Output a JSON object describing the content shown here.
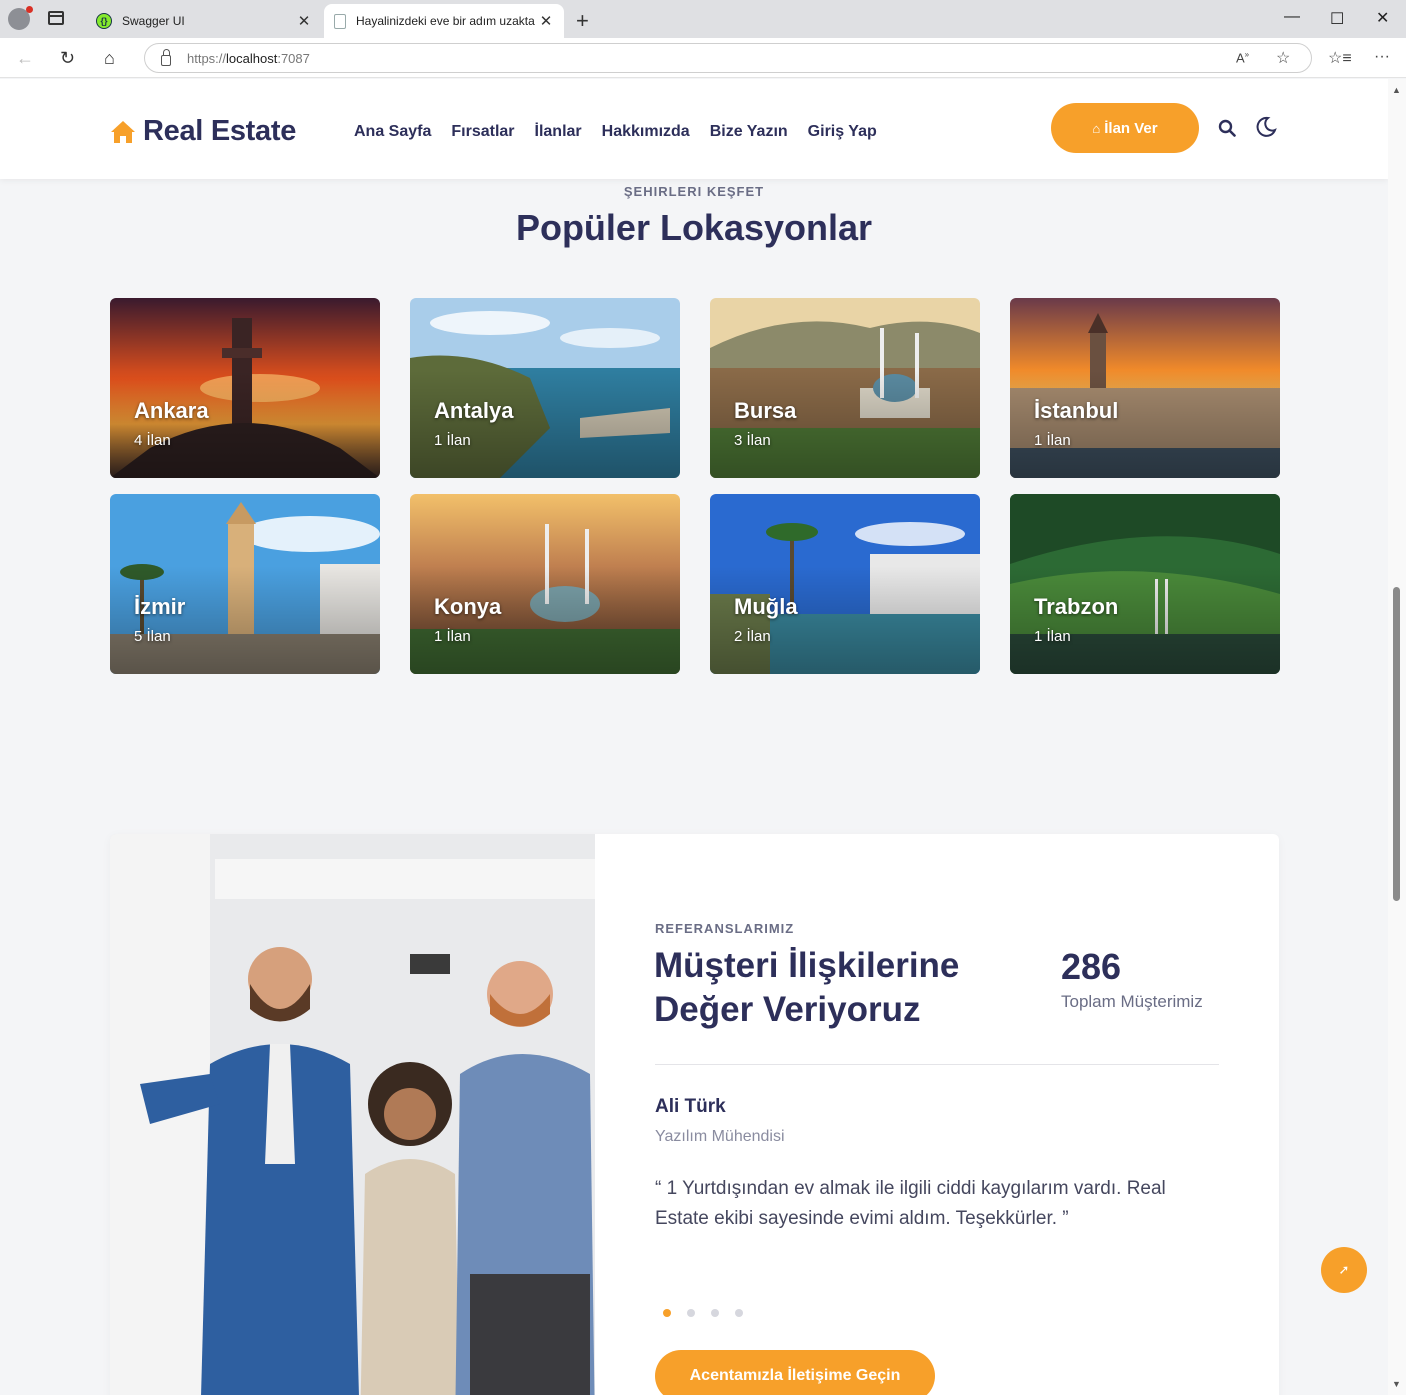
{
  "browser": {
    "tabs": [
      {
        "title": "Swagger UI",
        "active": false
      },
      {
        "title": "Hayalinizdeki eve bir adım uzakta",
        "active": true
      }
    ],
    "url_scheme": "https://",
    "url_host": "localhost",
    "url_port": ":7087"
  },
  "header": {
    "logo": "Real Estate",
    "nav": [
      "Ana Sayfa",
      "Fırsatlar",
      "İlanlar",
      "Hakkımızda",
      "Bize Yazın",
      "Giriş Yap"
    ],
    "cta": "İlan Ver"
  },
  "locations": {
    "subtitle": "ŞEHIRLERI KEŞFET",
    "title": "Popüler Lokasyonlar",
    "cards": [
      {
        "name": "Ankara",
        "count": "4 İlan"
      },
      {
        "name": "Antalya",
        "count": "1 İlan"
      },
      {
        "name": "Bursa",
        "count": "3 İlan"
      },
      {
        "name": "İstanbul",
        "count": "1 İlan"
      },
      {
        "name": "İzmir",
        "count": "5 İlan"
      },
      {
        "name": "Konya",
        "count": "1 İlan"
      },
      {
        "name": "Muğla",
        "count": "2 İlan"
      },
      {
        "name": "Trabzon",
        "count": "1 İlan"
      }
    ]
  },
  "testimonial": {
    "subtitle": "REFERANSLARIMIZ",
    "title": "Müşteri İlişkilerine Değer Veriyoruz",
    "count": "286",
    "count_label": "Toplam Müşterimiz",
    "name": "Ali Türk",
    "role": "Yazılım Mühendisi",
    "quote": "“ 1 Yurtdışından ev almak ile ilgili ciddi kaygılarım vardı. Real Estate ekibi sayesinde evimi aldım. Teşekkürler. ”",
    "slide_count": 4,
    "active_slide": 1,
    "cta": "Acentamızla İletişime Geçin"
  },
  "colors": {
    "accent": "#f7a02a",
    "heading": "#2d2f5a",
    "muted": "#6a6d85"
  }
}
